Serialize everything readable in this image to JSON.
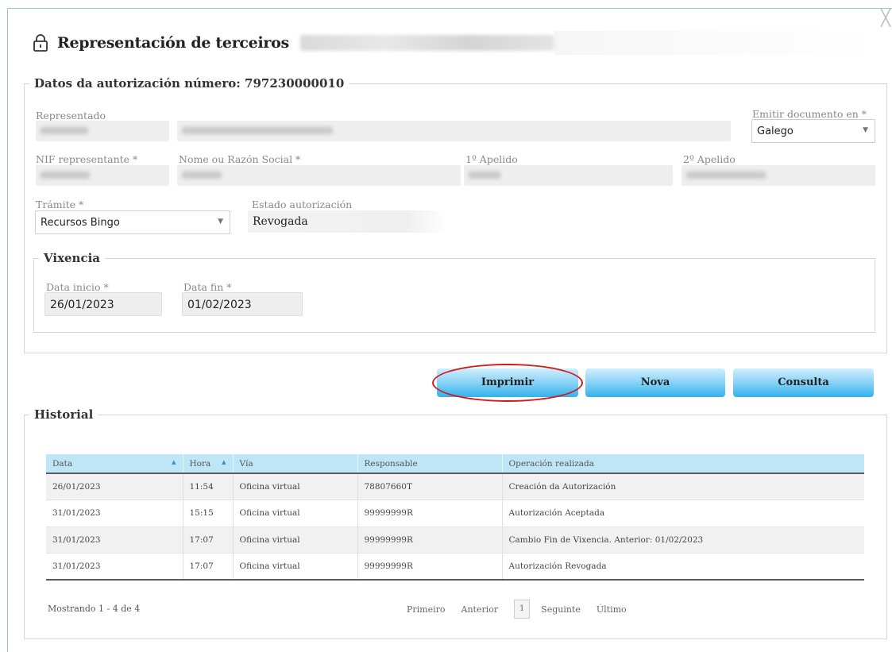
{
  "window": {
    "close_glyph": "╳"
  },
  "header": {
    "title": "Representación de terceiros",
    "lock_icon": "lock-icon"
  },
  "datos": {
    "legend": "Datos da autorización número: 797230000010",
    "representado_label": "Representado",
    "emitir_label": "Emitir documento en *",
    "emitir_value": "Galego",
    "nif_label": "NIF representante *",
    "nome_label": "Nome ou Razón Social *",
    "apelido1_label": "1º Apelido",
    "apelido2_label": "2º Apelido",
    "tramite_label": "Trámite *",
    "tramite_value": "Recursos Bingo",
    "estado_label": "Estado autorización",
    "estado_value": "Revogada"
  },
  "vixencia": {
    "legend": "Vixencia",
    "inicio_label": "Data inicio *",
    "inicio_value": "26/01/2023",
    "fin_label": "Data fin *",
    "fin_value": "01/02/2023"
  },
  "buttons": {
    "imprimir": "Imprimir",
    "nova": "Nova",
    "consulta": "Consulta"
  },
  "historial": {
    "legend": "Historial",
    "columns": [
      "Data",
      "Hora",
      "Vía",
      "Responsable",
      "Operación realizada"
    ],
    "rows": [
      [
        "26/01/2023",
        "11:54",
        "Oficina virtual",
        "78807660T",
        "Creación da Autorización"
      ],
      [
        "31/01/2023",
        "15:15",
        "Oficina virtual",
        "99999999R",
        "Autorización Aceptada"
      ],
      [
        "31/01/2023",
        "17:07",
        "Oficina virtual",
        "99999999R",
        "Cambio Fin de Vixencia. Anterior: 01/02/2023"
      ],
      [
        "31/01/2023",
        "17:07",
        "Oficina virtual",
        "99999999R",
        "Autorización Revogada"
      ]
    ],
    "showing": "Mostrando 1 - 4 de 4",
    "pager": {
      "first": "Primeiro",
      "prev": "Anterior",
      "page": "1",
      "next": "Seguinte",
      "last": "Último"
    }
  },
  "colors": {
    "accent": "#34b2ec",
    "highlight": "#d21a1a",
    "header_row": "#bfe6f7"
  }
}
